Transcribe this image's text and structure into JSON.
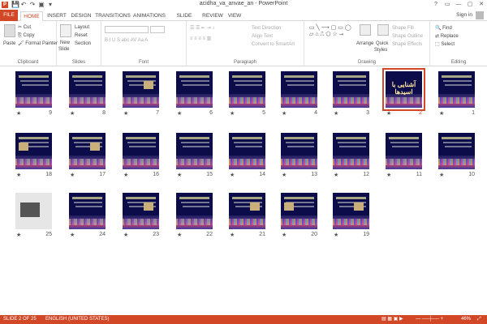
{
  "window": {
    "title": "acidha_va_anvae_an - PowerPoint",
    "signin": "Sign in",
    "controls": [
      "?",
      "▭",
      "—",
      "▢",
      "✕"
    ]
  },
  "qat": [
    "💾",
    "↶",
    "↷",
    "▣",
    "▾"
  ],
  "tabs": [
    "FILE",
    "HOME",
    "INSERT",
    "DESIGN",
    "TRANSITIONS",
    "ANIMATIONS",
    "SLIDE SHOW",
    "REVIEW",
    "VIEW"
  ],
  "ribbon": {
    "clipboard": {
      "paste": "Paste",
      "cut": "Cut",
      "copy": "Copy",
      "format_painter": "Format Painter",
      "label": "Clipboard"
    },
    "slides": {
      "new_slide": "New",
      "new_slide2": "Slide",
      "layout": "Layout",
      "reset": "Reset",
      "section": "Section",
      "label": "Slides"
    },
    "font": {
      "label": "Font"
    },
    "paragraph": {
      "text_direction": "Text Direction",
      "align_text": "Align Text",
      "convert": "Convert to SmartArt",
      "label": "Paragraph"
    },
    "drawing": {
      "arrange": "Arrange",
      "quick_styles": "Quick",
      "quick_styles2": "Styles",
      "shape_fill": "Shape Fill",
      "shape_outline": "Shape Outline",
      "shape_effects": "Shape Effects",
      "label": "Drawing"
    },
    "editing": {
      "find": "Find",
      "replace": "Replace",
      "select": "Select",
      "label": "Editing"
    }
  },
  "slides": [
    {
      "num": "9"
    },
    {
      "num": "8"
    },
    {
      "num": "7"
    },
    {
      "num": "6"
    },
    {
      "num": "5"
    },
    {
      "num": "4"
    },
    {
      "num": "3"
    },
    {
      "num": "2",
      "title": "آشنایی با اسیدها"
    },
    {
      "num": "1"
    },
    {
      "num": "18"
    },
    {
      "num": "17"
    },
    {
      "num": "16"
    },
    {
      "num": "15"
    },
    {
      "num": "14"
    },
    {
      "num": "13"
    },
    {
      "num": "12"
    },
    {
      "num": "11"
    },
    {
      "num": "10"
    },
    {
      "num": "25"
    },
    {
      "num": "24"
    },
    {
      "num": "23"
    },
    {
      "num": "22"
    },
    {
      "num": "21"
    },
    {
      "num": "20"
    },
    {
      "num": "19"
    }
  ],
  "status": {
    "slide": "SLIDE 2 OF 25",
    "language": "ENGLISH (UNITED STATES)",
    "zoom": "46%"
  },
  "colors": {
    "accent": "#d24726"
  }
}
